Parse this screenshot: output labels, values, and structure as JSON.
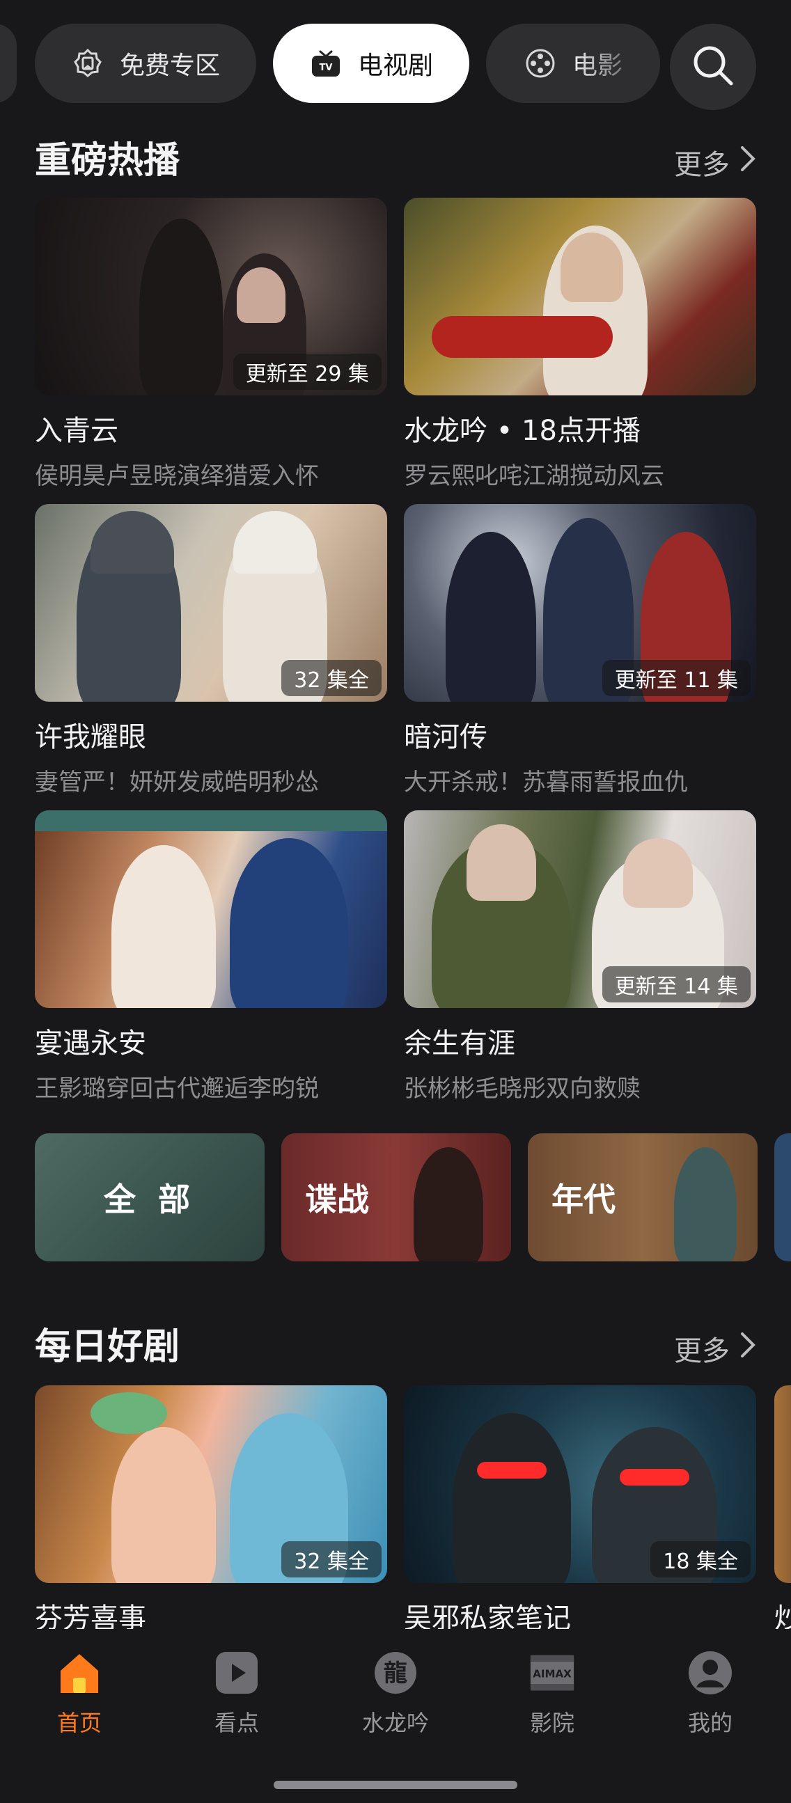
{
  "tabs": {
    "free_zone": "免费专区",
    "tv": "电视剧",
    "movie": "电影"
  },
  "hot": {
    "title": "重磅热播",
    "more": "更多",
    "cards": [
      {
        "title": "入青云",
        "subtitle": "侯明昊卢昱晓演绎猎爱入怀",
        "badge": "更新至 29 集"
      },
      {
        "title": "水龙吟 • 18点开播",
        "subtitle": "罗云熙叱咤江湖搅动风云",
        "badge": ""
      },
      {
        "title": "许我耀眼",
        "subtitle": "妻管严！妍妍发威皓明秒怂",
        "badge": "32 集全"
      },
      {
        "title": "暗河传",
        "subtitle": "大开杀戒！苏暮雨誓报血仇",
        "badge": "更新至 11 集"
      },
      {
        "title": "宴遇永安",
        "subtitle": "王影璐穿回古代邂逅李昀锐",
        "badge": ""
      },
      {
        "title": "余生有涯",
        "subtitle": "张彬彬毛晓彤双向救赎",
        "badge": "更新至 14 集"
      }
    ]
  },
  "genres": [
    "全 部",
    "谍战",
    "年代"
  ],
  "daily": {
    "title": "每日好剧",
    "more": "更多",
    "cards": [
      {
        "title": "芬芳喜事",
        "badge": "32 集全"
      },
      {
        "title": "吴邪私家笔记",
        "badge": "18 集全"
      }
    ],
    "peek_title": "炒"
  },
  "bottom_nav": [
    {
      "label": "首页",
      "icon": "home-icon",
      "active": true
    },
    {
      "label": "看点",
      "icon": "play-icon",
      "active": false
    },
    {
      "label": "水龙吟",
      "icon": "dragon-icon",
      "active": false
    },
    {
      "label": "影院",
      "icon": "cinema-icon",
      "active": false
    },
    {
      "label": "我的",
      "icon": "profile-icon",
      "active": false
    }
  ],
  "colors": {
    "background": "#18181b",
    "accent": "#ff7a1a",
    "pill": "#2e2e31"
  }
}
